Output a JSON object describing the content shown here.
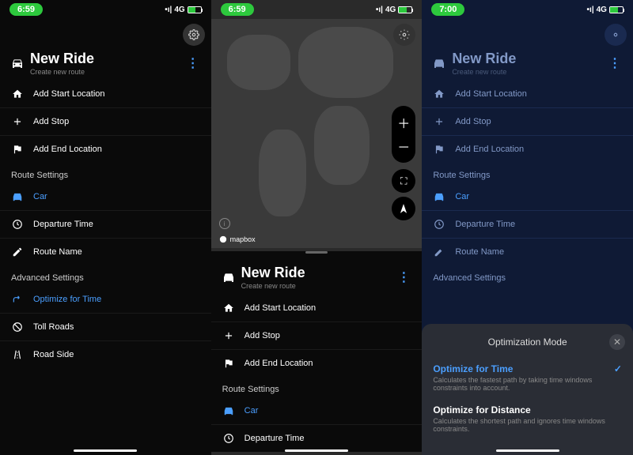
{
  "status": {
    "time1": "6:59",
    "time2": "6:59",
    "time3": "7:00",
    "signal": "4G"
  },
  "header": {
    "title": "New Ride",
    "subtitle": "Create new route"
  },
  "locations": {
    "start": "Add Start Location",
    "stop": "Add Stop",
    "end": "Add End Location"
  },
  "route_settings": {
    "header": "Route Settings",
    "car": "Car",
    "departure": "Departure Time",
    "route_name": "Route Name"
  },
  "advanced": {
    "header": "Advanced Settings",
    "optimize": "Optimize for Time",
    "toll": "Toll Roads",
    "roadside": "Road Side"
  },
  "map": {
    "attribution": "mapbox"
  },
  "modal": {
    "title": "Optimization Mode",
    "opt1_title": "Optimize for Time",
    "opt1_desc": "Calculates the fastest path by taking time windows constraints into account.",
    "opt2_title": "Optimize for Distance",
    "opt2_desc": "Calculates the shortest path and ignores time windows constraints."
  }
}
